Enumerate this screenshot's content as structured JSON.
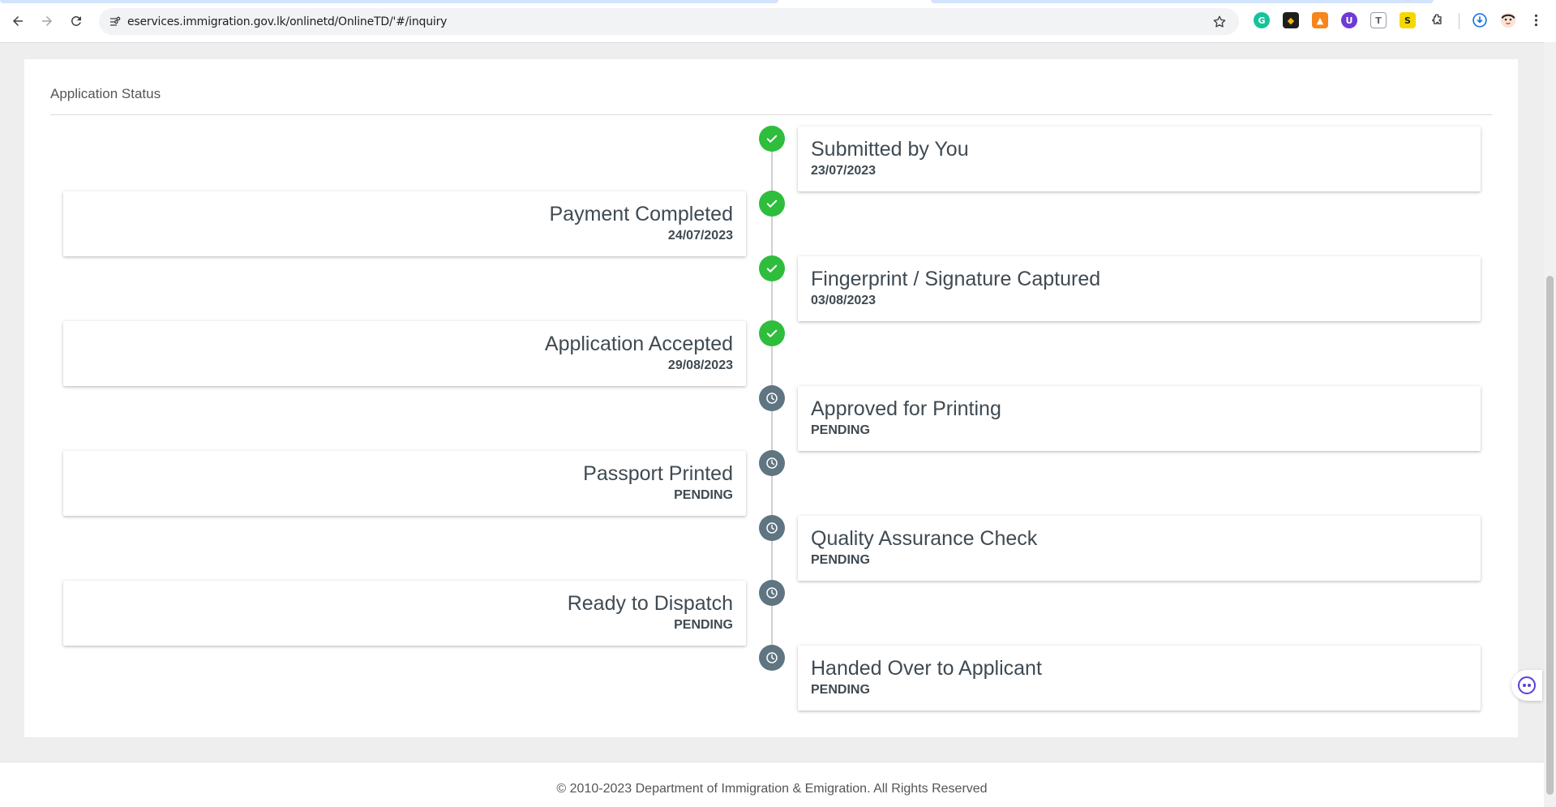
{
  "browser": {
    "url": "eservices.immigration.gov.lk/onlinetd/OnlineTD/'#/inquiry",
    "extensions": [
      {
        "name": "grammarly-icon",
        "label": "G",
        "color": "#15c39a"
      },
      {
        "name": "binance-icon",
        "label": "◆",
        "color": "#1e1e1e"
      },
      {
        "name": "metamask-icon",
        "label": "▲",
        "color": "#f6851b"
      },
      {
        "name": "extension-purple-icon",
        "label": "U",
        "color": "#6e3bd6"
      },
      {
        "name": "text-extension-icon",
        "label": "T",
        "color": "#9aa0a6"
      },
      {
        "name": "yellow-extension-icon",
        "label": "S",
        "color": "#f5d800"
      }
    ]
  },
  "page": {
    "section_title": "Application Status",
    "timeline": [
      {
        "title": "Submitted by You",
        "date": "23/07/2023",
        "status": "done"
      },
      {
        "title": "Payment Completed",
        "date": "24/07/2023",
        "status": "done"
      },
      {
        "title": "Fingerprint / Signature Captured",
        "date": "03/08/2023",
        "status": "done"
      },
      {
        "title": "Application Accepted",
        "date": "29/08/2023",
        "status": "done"
      },
      {
        "title": "Approved for Printing",
        "date": "PENDING",
        "status": "pending"
      },
      {
        "title": "Passport Printed",
        "date": "PENDING",
        "status": "pending"
      },
      {
        "title": "Quality Assurance Check",
        "date": "PENDING",
        "status": "pending"
      },
      {
        "title": "Ready to Dispatch",
        "date": "PENDING",
        "status": "pending"
      },
      {
        "title": "Handed Over to Applicant",
        "date": "PENDING",
        "status": "pending"
      }
    ],
    "footer": "© 2010-2023 Department of Immigration & Emigration. All Rights Reserved"
  },
  "colors": {
    "done": "#2ebd3c",
    "pending": "#607582"
  }
}
